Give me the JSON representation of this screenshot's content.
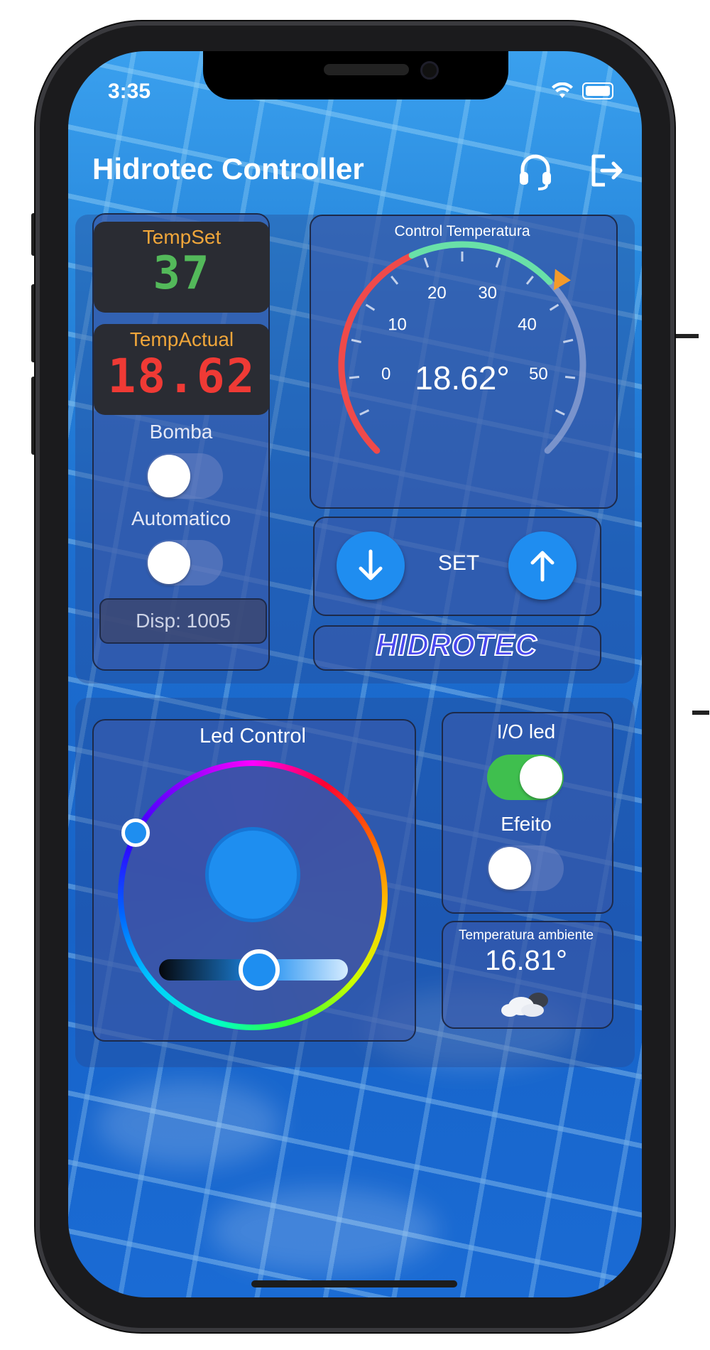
{
  "status_bar": {
    "time": "3:35"
  },
  "app_bar": {
    "title": "Hidrotec Controller",
    "support_icon": "headset-icon",
    "logout_icon": "logout-icon"
  },
  "temp_set": {
    "label": "TempSet",
    "value": "37"
  },
  "temp_actual": {
    "label": "TempActual",
    "value": "18.62"
  },
  "bomba": {
    "label": "Bomba",
    "on": false
  },
  "automatico": {
    "label": "Automatico",
    "on": false
  },
  "disp": {
    "text": "Disp: 1005"
  },
  "gauge": {
    "title": "Control Temperatura",
    "value_text": "18.62°",
    "ticks": [
      "0",
      "10",
      "20",
      "30",
      "40",
      "50"
    ],
    "min": -10,
    "max": 60,
    "value": 18.62,
    "set_value": 37,
    "colors": {
      "cold": "#ef4a4a",
      "ok": "#69e0a8",
      "marker": "#f39a2a"
    }
  },
  "set_controls": {
    "label": "SET",
    "down_icon": "arrow-down-icon",
    "up_icon": "arrow-up-icon"
  },
  "brand": {
    "text": "HIDROTEC"
  },
  "led_control": {
    "title": "Led Control",
    "color_hex": "#1e8ef0"
  },
  "io_led": {
    "label": "I/O led",
    "on": true
  },
  "efeito": {
    "label": "Efeito",
    "on": false
  },
  "ambient": {
    "label": "Temperatura ambiente",
    "value": "16.81°",
    "icon": "cloudy-icon"
  }
}
